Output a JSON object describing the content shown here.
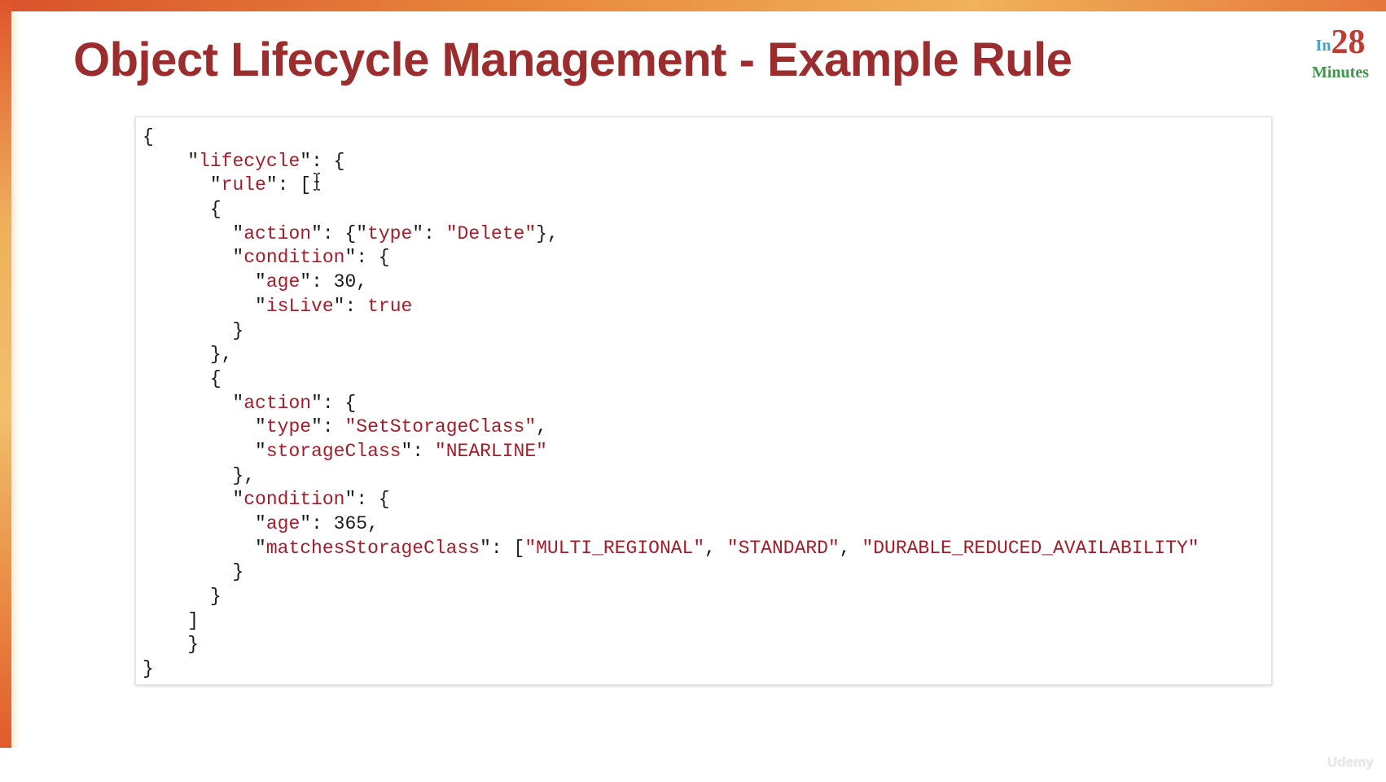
{
  "slide": {
    "title": "Object Lifecycle Management - Example Rule",
    "logo": {
      "prefix": "In",
      "number": "28",
      "word": "Minutes"
    },
    "watermark": "Udemy"
  },
  "code": {
    "lines": [
      {
        "indent": 0,
        "tokens": [
          {
            "t": "p",
            "v": "{"
          }
        ]
      },
      {
        "indent": 4,
        "tokens": [
          {
            "t": "p",
            "v": "\""
          },
          {
            "t": "k",
            "v": "lifecycle"
          },
          {
            "t": "p",
            "v": "\": {"
          }
        ]
      },
      {
        "indent": 6,
        "tokens": [
          {
            "t": "p",
            "v": "\""
          },
          {
            "t": "k",
            "v": "rule"
          },
          {
            "t": "p",
            "v": "\": ["
          }
        ]
      },
      {
        "indent": 6,
        "tokens": [
          {
            "t": "p",
            "v": "{"
          }
        ]
      },
      {
        "indent": 8,
        "tokens": [
          {
            "t": "p",
            "v": "\""
          },
          {
            "t": "k",
            "v": "action"
          },
          {
            "t": "p",
            "v": "\": {\""
          },
          {
            "t": "k",
            "v": "type"
          },
          {
            "t": "p",
            "v": "\": "
          },
          {
            "t": "s",
            "v": "\"Delete\""
          },
          {
            "t": "p",
            "v": "},"
          }
        ]
      },
      {
        "indent": 8,
        "tokens": [
          {
            "t": "p",
            "v": "\""
          },
          {
            "t": "k",
            "v": "condition"
          },
          {
            "t": "p",
            "v": "\": {"
          }
        ]
      },
      {
        "indent": 10,
        "tokens": [
          {
            "t": "p",
            "v": "\""
          },
          {
            "t": "k",
            "v": "age"
          },
          {
            "t": "p",
            "v": "\": 30,"
          }
        ]
      },
      {
        "indent": 10,
        "tokens": [
          {
            "t": "p",
            "v": "\""
          },
          {
            "t": "k",
            "v": "isLive"
          },
          {
            "t": "p",
            "v": "\": "
          },
          {
            "t": "s",
            "v": "true"
          }
        ]
      },
      {
        "indent": 8,
        "tokens": [
          {
            "t": "p",
            "v": "}"
          }
        ]
      },
      {
        "indent": 6,
        "tokens": [
          {
            "t": "p",
            "v": "},"
          }
        ]
      },
      {
        "indent": 6,
        "tokens": [
          {
            "t": "p",
            "v": "{"
          }
        ]
      },
      {
        "indent": 8,
        "tokens": [
          {
            "t": "p",
            "v": "\""
          },
          {
            "t": "k",
            "v": "action"
          },
          {
            "t": "p",
            "v": "\": {"
          }
        ]
      },
      {
        "indent": 10,
        "tokens": [
          {
            "t": "p",
            "v": "\""
          },
          {
            "t": "k",
            "v": "type"
          },
          {
            "t": "p",
            "v": "\": "
          },
          {
            "t": "s",
            "v": "\"SetStorageClass\""
          },
          {
            "t": "p",
            "v": ","
          }
        ]
      },
      {
        "indent": 10,
        "tokens": [
          {
            "t": "p",
            "v": "\""
          },
          {
            "t": "k",
            "v": "storageClass"
          },
          {
            "t": "p",
            "v": "\": "
          },
          {
            "t": "s",
            "v": "\"NEARLINE\""
          }
        ]
      },
      {
        "indent": 8,
        "tokens": [
          {
            "t": "p",
            "v": "},"
          }
        ]
      },
      {
        "indent": 8,
        "tokens": [
          {
            "t": "p",
            "v": "\""
          },
          {
            "t": "k",
            "v": "condition"
          },
          {
            "t": "p",
            "v": "\": {"
          }
        ]
      },
      {
        "indent": 10,
        "tokens": [
          {
            "t": "p",
            "v": "\""
          },
          {
            "t": "k",
            "v": "age"
          },
          {
            "t": "p",
            "v": "\": 365,"
          }
        ]
      },
      {
        "indent": 10,
        "tokens": [
          {
            "t": "p",
            "v": "\""
          },
          {
            "t": "k",
            "v": "matchesStorageClass"
          },
          {
            "t": "p",
            "v": "\": ["
          },
          {
            "t": "s",
            "v": "\"MULTI_REGIONAL\""
          },
          {
            "t": "p",
            "v": ", "
          },
          {
            "t": "s",
            "v": "\"STANDARD\""
          },
          {
            "t": "p",
            "v": ", "
          },
          {
            "t": "s",
            "v": "\"DURABLE_REDUCED_AVAILABILITY\""
          }
        ]
      },
      {
        "indent": 8,
        "tokens": [
          {
            "t": "p",
            "v": "}"
          }
        ]
      },
      {
        "indent": 6,
        "tokens": [
          {
            "t": "p",
            "v": "}"
          }
        ]
      },
      {
        "indent": 4,
        "tokens": [
          {
            "t": "p",
            "v": "]"
          }
        ]
      },
      {
        "indent": 4,
        "tokens": [
          {
            "t": "p",
            "v": "}"
          }
        ]
      },
      {
        "indent": 0,
        "tokens": [
          {
            "t": "p",
            "v": "}"
          }
        ]
      }
    ]
  },
  "colors": {
    "title": "#9b2d2e",
    "key": "#a11d2a",
    "punctuation": "#1a1a1a",
    "accent_orange": "#e98a3d"
  },
  "icons": {
    "cursor": "text-cursor-icon"
  }
}
